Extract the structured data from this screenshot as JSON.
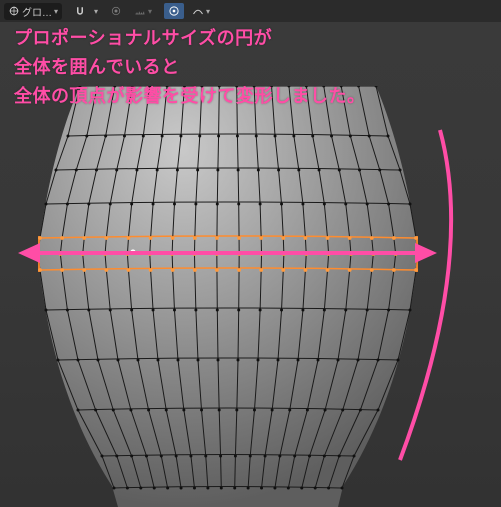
{
  "toolbar": {
    "orientation_label": "グロ…",
    "icons": {
      "orientation": "orientation-icon",
      "snap": "magnet-icon",
      "snap_mode": "snap-vertex-icon",
      "proportional": "proportional-edit-icon",
      "falloff": "falloff-smooth-icon"
    }
  },
  "annotation": {
    "line1": "プロポーショナルサイズの円が",
    "line2": "全体を囲んでいると",
    "line3": "全体の頂点が影響を受けて変形しました。"
  },
  "colors": {
    "annotation": "#ff4da6",
    "mesh_face": "#9d9d9d",
    "mesh_wire": "#1a1a1a",
    "mesh_selected": "#ff8c2e",
    "mesh_vertex_selected": "#ffffff",
    "arrow": "#ff4da6"
  }
}
